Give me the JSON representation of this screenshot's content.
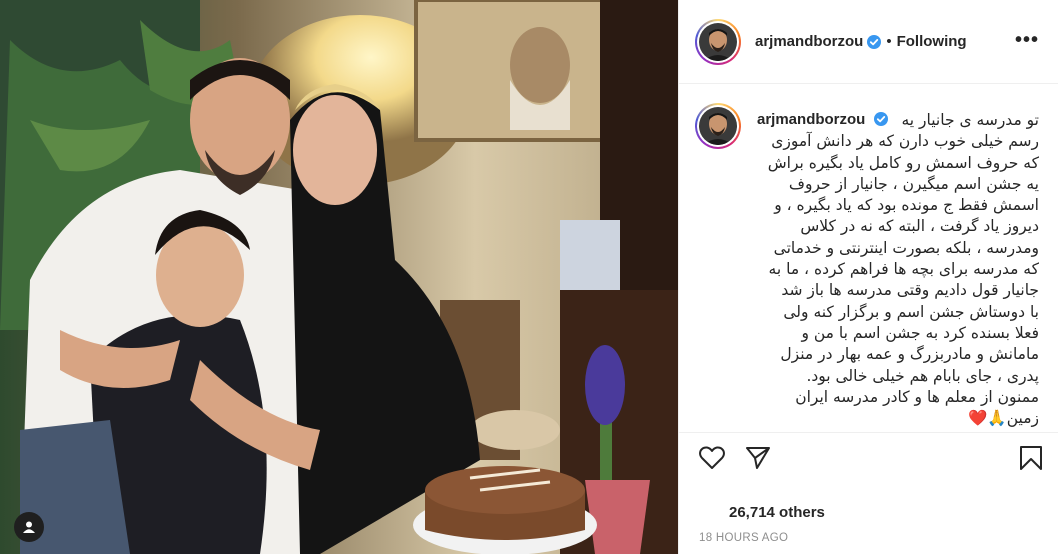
{
  "post": {
    "username": "arjmandborzou",
    "follow_state": "Following",
    "separator": "•",
    "more_icon": "more-horizontal-icon",
    "caption_lines": [
      "تو مدرسه ی جانیار یه",
      "رسم خیلی خوب دارن که هر دانش آموزی",
      "که حروف اسمش رو کامل یاد بگیره براش",
      "یه جشن اسم میگیرن ، جانیار از حروف",
      "اسمش فقط ج مونده بود که یاد بگیره ، و",
      "دیروز یاد گرفت ، البته که نه در کلاس",
      "ومدرسه ، بلکه بصورت اینترنتی و خدماتی",
      "که مدرسه برای بچه ها فراهم کرده ، ما به",
      "جانیار قول دادیم وقتی مدرسه ها باز شد",
      "با دوستاش جشن اسم و برگزار کنه ولی",
      "فعلا بسنده کرد به جشن اسم با من و",
      "مامانش و مادربزرگ و عمه بهار در منزل",
      "پدری ، جای بابام هم خیلی خالی بود.",
      "ممنون از معلم ها و کادر مدرسه ایران",
      "زمین🙏❤️"
    ],
    "likes": "26,714 others",
    "timestamp": "18 HOURS AGO"
  },
  "icons": {
    "like": "heart-icon",
    "share": "paper-plane-icon",
    "save": "bookmark-icon",
    "tag": "user-tag-icon",
    "verified": "verified-badge-icon"
  },
  "colors": {
    "verified": "#3897f0",
    "text": "#262626",
    "muted": "#8e8e8e",
    "border": "#efefef"
  }
}
